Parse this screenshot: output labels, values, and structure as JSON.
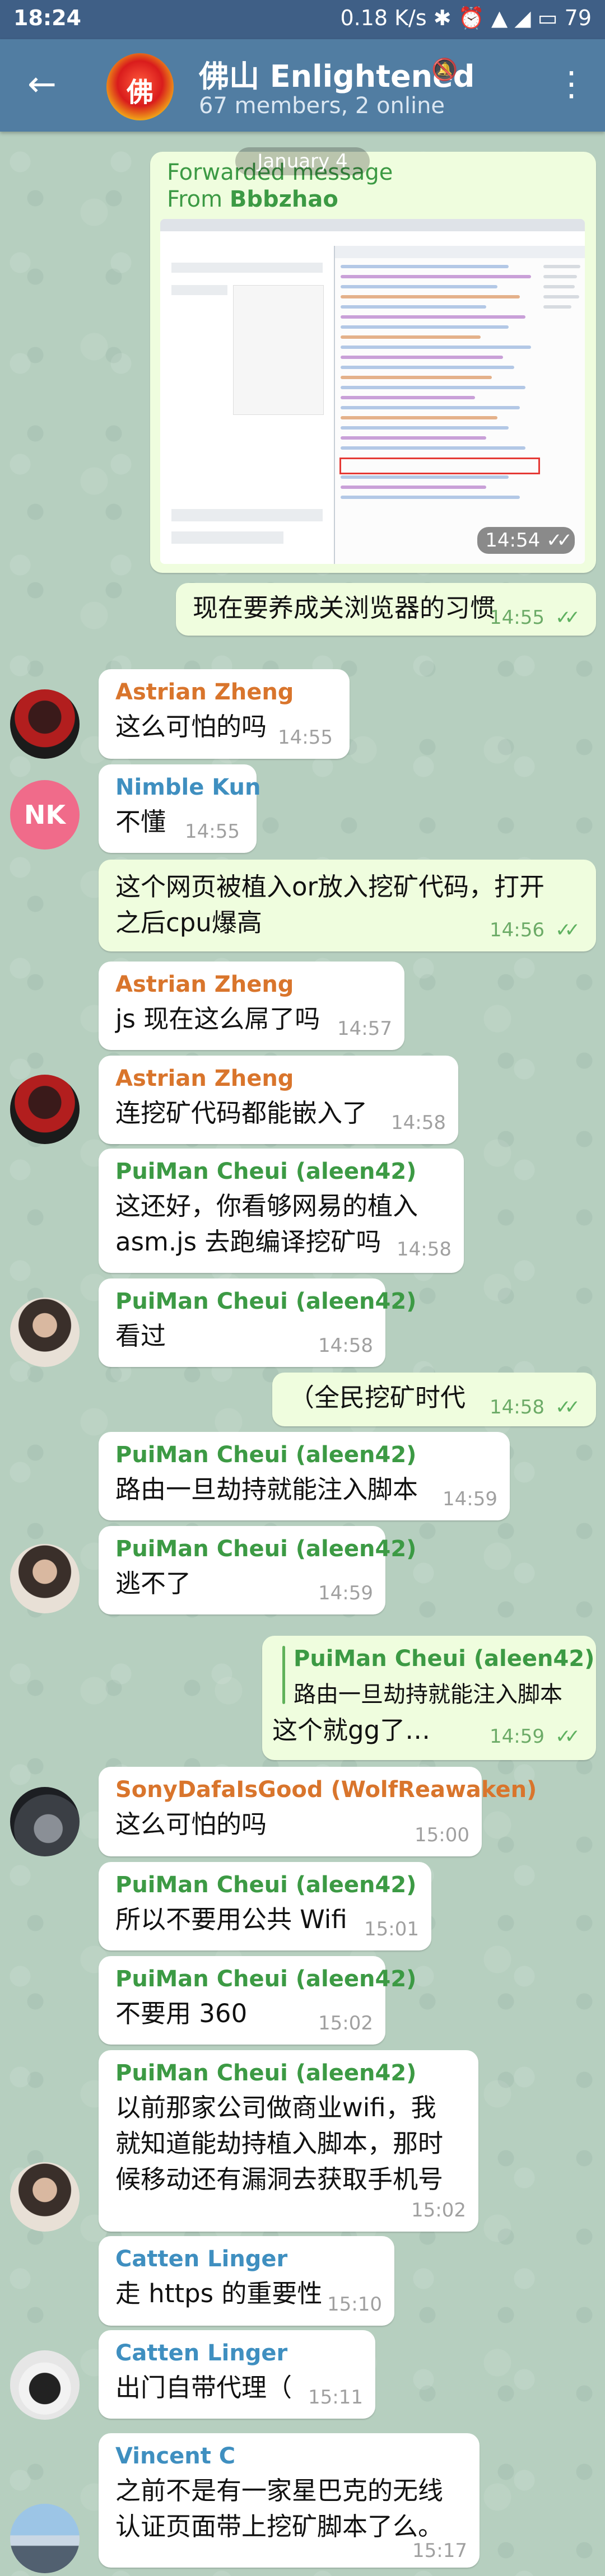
{
  "status_bar": {
    "time": "18:24",
    "right": "0.18 K/s  ✱  ⏰  ▲ ◢  ▭ 79"
  },
  "header": {
    "title": "佛山 Enlightened",
    "subtitle": "67 members, 2 online",
    "avatar_text": "佛",
    "back_icon": "←",
    "mute_icon": "🔕",
    "menu_icon": "⋮"
  },
  "date_label": "January 4",
  "forwarded": {
    "line1": "Forwarded message",
    "line2_prefix": "From ",
    "from": "Bbbzhao",
    "time": "14:54"
  },
  "colors": {
    "header": "#517da2",
    "status": "#3f5f86",
    "out_bubble": "#effdde",
    "in_bubble": "#ffffff",
    "check": "#5fb160"
  },
  "messages": [
    {
      "id": "m1",
      "text": "现在要养成关浏览器的习惯",
      "time": "14:55"
    },
    {
      "id": "m2",
      "sender": "Astrian Zheng",
      "text": "这么可怕的吗",
      "time": "14:55"
    },
    {
      "id": "m3",
      "sender": "Nimble Kun",
      "avatar": "NK",
      "text": "不懂",
      "time": "14:55"
    },
    {
      "id": "m4",
      "lines": [
        "这个网页被植入or放入挖矿代码，打开",
        "之后cpu爆高"
      ],
      "time": "14:56"
    },
    {
      "id": "m5",
      "sender": "Astrian Zheng",
      "text": "js 现在这么屌了吗",
      "time": "14:57"
    },
    {
      "id": "m6",
      "sender": "Astrian Zheng",
      "text": "连挖矿代码都能嵌入了",
      "time": "14:58"
    },
    {
      "id": "m7",
      "sender": "PuiMan Cheui (aleen42)",
      "lines": [
        "这还好，你看够网易的植入",
        "asm.js 去跑编译挖矿吗"
      ],
      "time": "14:58"
    },
    {
      "id": "m8",
      "sender": "PuiMan Cheui (aleen42)",
      "text": "看过",
      "time": "14:58"
    },
    {
      "id": "m9",
      "text": "（全民挖矿时代",
      "time": "14:58"
    },
    {
      "id": "m10",
      "sender": "PuiMan Cheui (aleen42)",
      "text": "路由一旦劫持就能注入脚本",
      "time": "14:59"
    },
    {
      "id": "m11",
      "sender": "PuiMan Cheui (aleen42)",
      "text": "逃不了",
      "time": "14:59"
    },
    {
      "id": "m12",
      "quote_name": "PuiMan Cheui (aleen42)",
      "quote_text": "路由一旦劫持就能注入脚本",
      "text": "这个就gg了…",
      "time": "14:59"
    },
    {
      "id": "m13",
      "sender": "SonyDafaIsGood (WolfReawaken)",
      "text": "这么可怕的吗",
      "time": "15:00"
    },
    {
      "id": "m14",
      "sender": "PuiMan Cheui (aleen42)",
      "text": "所以不要用公共 Wifi",
      "time": "15:01"
    },
    {
      "id": "m15",
      "sender": "PuiMan Cheui (aleen42)",
      "text": "不要用 360",
      "time": "15:02"
    },
    {
      "id": "m16",
      "sender": "PuiMan Cheui (aleen42)",
      "lines": [
        "以前那家公司做商业wifi，我",
        "就知道能劫持植入脚本，那时",
        "候移动还有漏洞去获取手机号"
      ],
      "time": "15:02"
    },
    {
      "id": "m17",
      "sender": "Catten Linger",
      "text": "走 https 的重要性",
      "time": "15:10"
    },
    {
      "id": "m18",
      "sender": "Catten Linger",
      "text": "出门自带代理（",
      "time": "15:11"
    },
    {
      "id": "m19",
      "sender": "Vincent C",
      "lines": [
        "之前不是有一家星巴克的无线",
        "认证页面带上挖矿脚本了么。"
      ],
      "time": "15:17"
    }
  ],
  "sender_colors": {
    "Astrian Zheng": "#d9752c",
    "Nimble Kun": "#3f8fc0",
    "PuiMan Cheui (aleen42)": "#3c9a44",
    "SonyDafaIsGood (WolfReawaken)": "#d9752c",
    "Catten Linger": "#3f8fc0",
    "Vincent C": "#3f8fc0"
  }
}
